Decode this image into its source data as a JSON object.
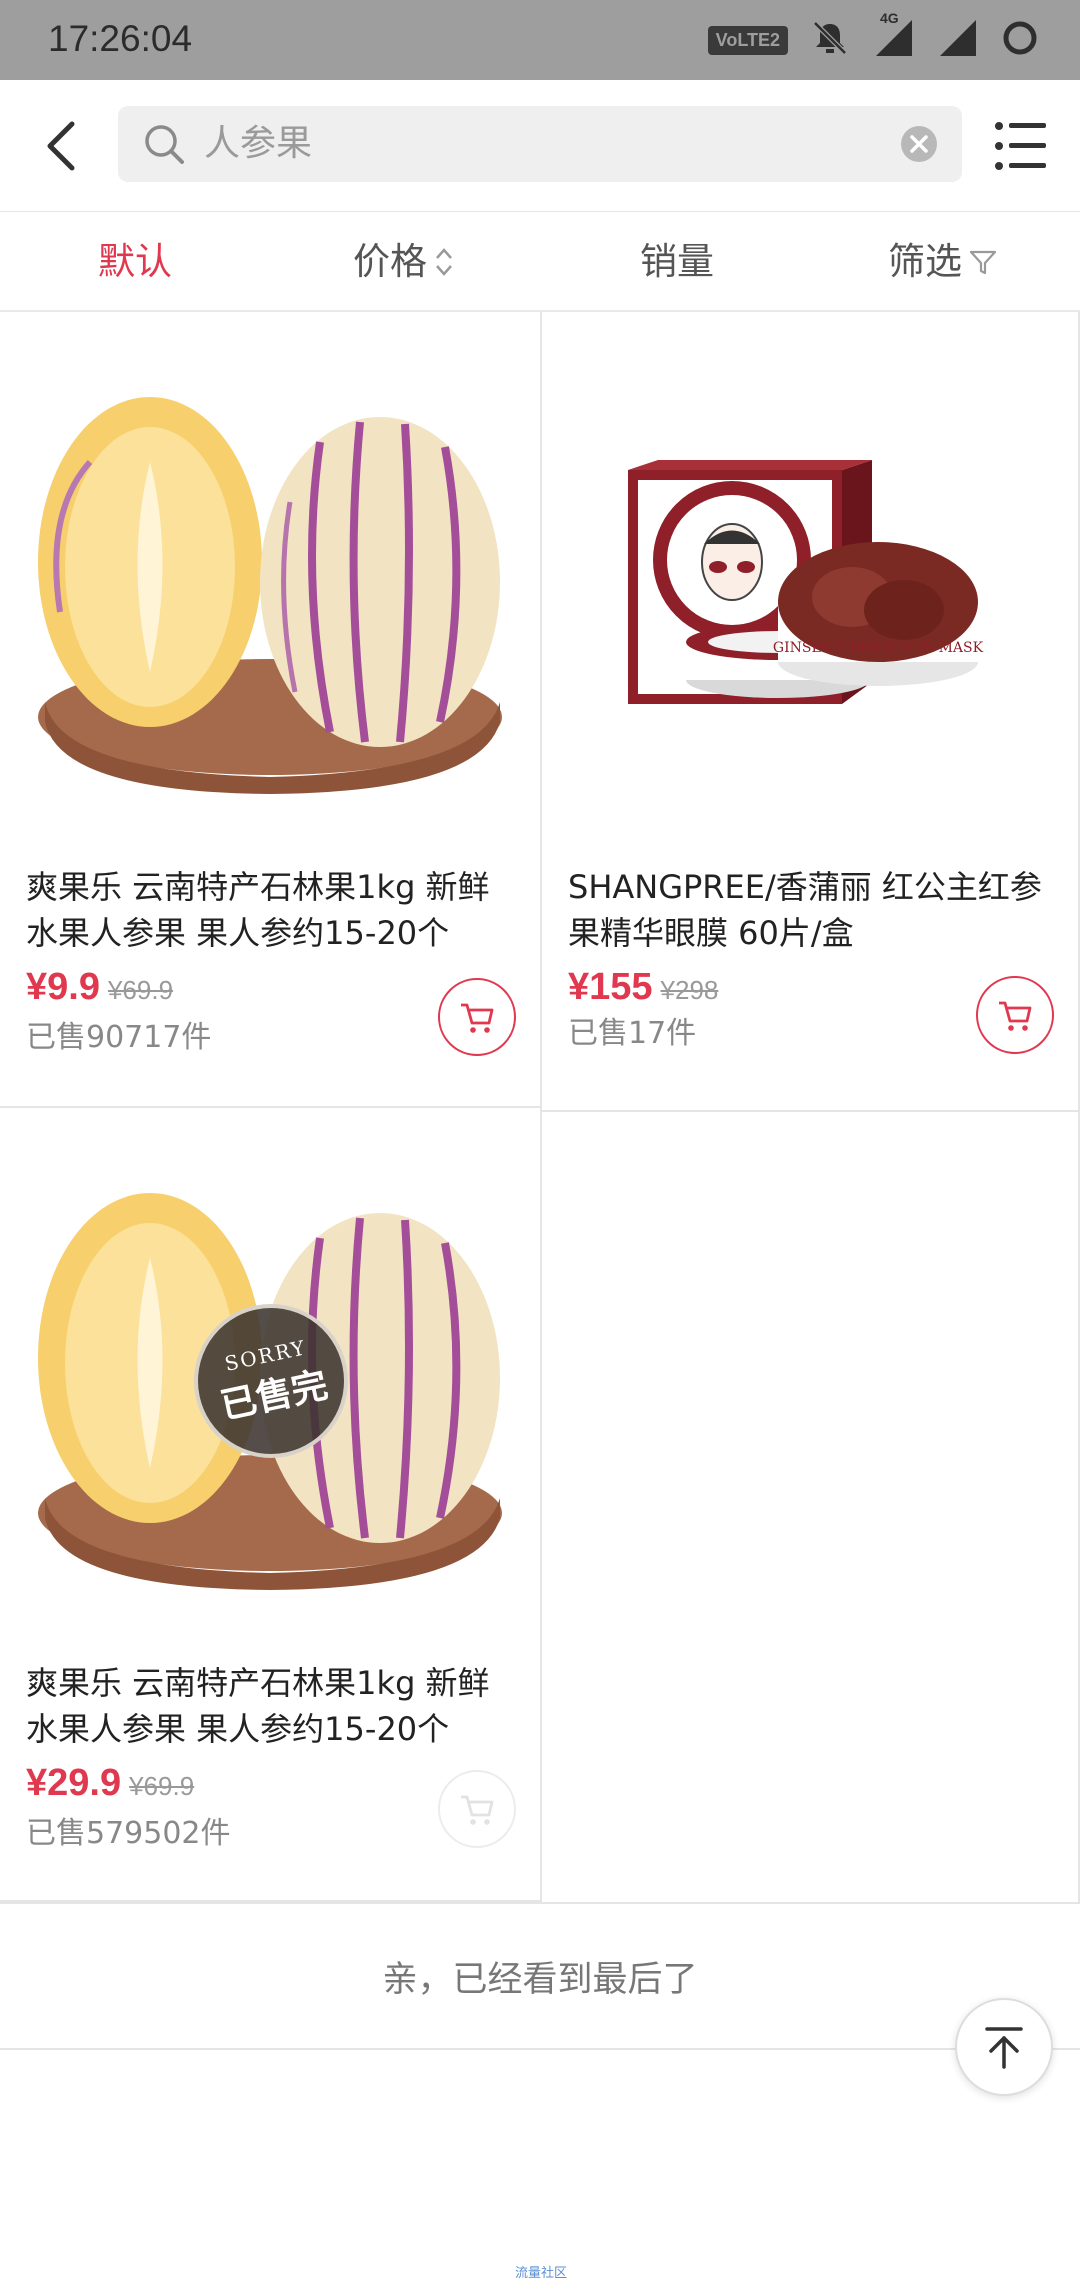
{
  "status_bar": {
    "time": "17:26:04",
    "volte": "VoLTE2",
    "network": "4G"
  },
  "header": {
    "search_value": "人参果"
  },
  "tabs": [
    {
      "label": "默认",
      "active": true
    },
    {
      "label": "价格",
      "active": false
    },
    {
      "label": "销量",
      "active": false
    },
    {
      "label": "筛选",
      "active": false
    }
  ],
  "products": [
    {
      "title": "爽果乐 云南特产石林果1kg 新鲜水果人参果 果人参约15-20个",
      "price": "¥9.9",
      "original_price": "¥69.9",
      "sold": "已售90717件",
      "sold_out": false
    },
    {
      "title": "SHANGPREE/香蒲丽 红公主红参果精华眼膜 60片/盒",
      "price": "¥155",
      "original_price": "¥298",
      "sold": "已售17件",
      "sold_out": false,
      "box_text": "GINSENG BERRY EYE MASK"
    },
    {
      "title": "爽果乐 云南特产石林果1kg 新鲜水果人参果 果人参约15-20个",
      "price": "¥29.9",
      "original_price": "¥69.9",
      "sold": "已售579502件",
      "sold_out": true,
      "sold_out_badge": {
        "top": "SORRY",
        "main": "已售完"
      }
    }
  ],
  "footer_message": "亲，已经看到最后了",
  "watermark": "流量社区",
  "colors": {
    "accent": "#e0394f",
    "status_bar": "#9e9e9e"
  }
}
